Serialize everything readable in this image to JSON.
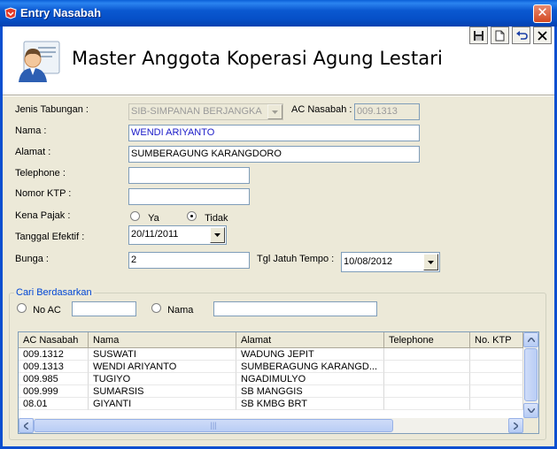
{
  "window": {
    "title": "Entry Nasabah",
    "close_glyph": "✕"
  },
  "header": {
    "title": "Master Anggota Koperasi Agung Lestari",
    "toolbar": [
      "save-icon",
      "new-icon",
      "undo-icon",
      "close-icon"
    ]
  },
  "form": {
    "jenis_tabungan_label": "Jenis Tabungan :",
    "jenis_tabungan_value": "SIB-SIMPANAN BERJANGKA",
    "ac_nasabah_label": "AC Nasabah :",
    "ac_nasabah_value": "009.1313",
    "nama_label": "Nama :",
    "nama_value": "WENDI ARIYANTO",
    "alamat_label": "Alamat :",
    "alamat_value": "SUMBERAGUNG KARANGDORO",
    "telephone_label": "Telephone :",
    "telephone_value": "",
    "ktp_label": "Nomor KTP :",
    "ktp_value": "",
    "pajak_label": "Kena Pajak :",
    "pajak_ya": "Ya",
    "pajak_tidak": "Tidak",
    "pajak_selected": "Tidak",
    "tanggal_label": "Tanggal Efektif :",
    "tanggal_value": "20/11/2011",
    "bunga_label": "Bunga :",
    "bunga_value": "2",
    "jatuh_tempo_label": "Tgl Jatuh Tempo :",
    "jatuh_tempo_value": "10/08/2012"
  },
  "search": {
    "legend": "Cari Berdasarkan",
    "no_ac_label": "No AC",
    "no_ac_value": "",
    "nama_label": "Nama",
    "nama_value": ""
  },
  "grid": {
    "columns": [
      "AC Nasabah",
      "Nama",
      "Alamat",
      "Telephone",
      "No. KTP"
    ],
    "rows": [
      [
        "009.1312",
        "SUSWATI",
        "WADUNG JEPIT",
        "",
        ""
      ],
      [
        "009.1313",
        "WENDI ARIYANTO",
        "SUMBERAGUNG KARANGD...",
        "",
        ""
      ],
      [
        "009.985",
        "TUGIYO",
        "NGADIMULYO",
        "",
        ""
      ],
      [
        "009.999",
        "SUMARSIS",
        "SB MANGGIS",
        "",
        ""
      ],
      [
        "08.01",
        "GIYANTI",
        "SB KMBG BRT",
        "",
        ""
      ]
    ],
    "scroll_grip": "|||"
  },
  "colors": {
    "titlebar": "#0a58d0",
    "legend": "#0046d5",
    "selected_text": "#1a1ac8"
  }
}
